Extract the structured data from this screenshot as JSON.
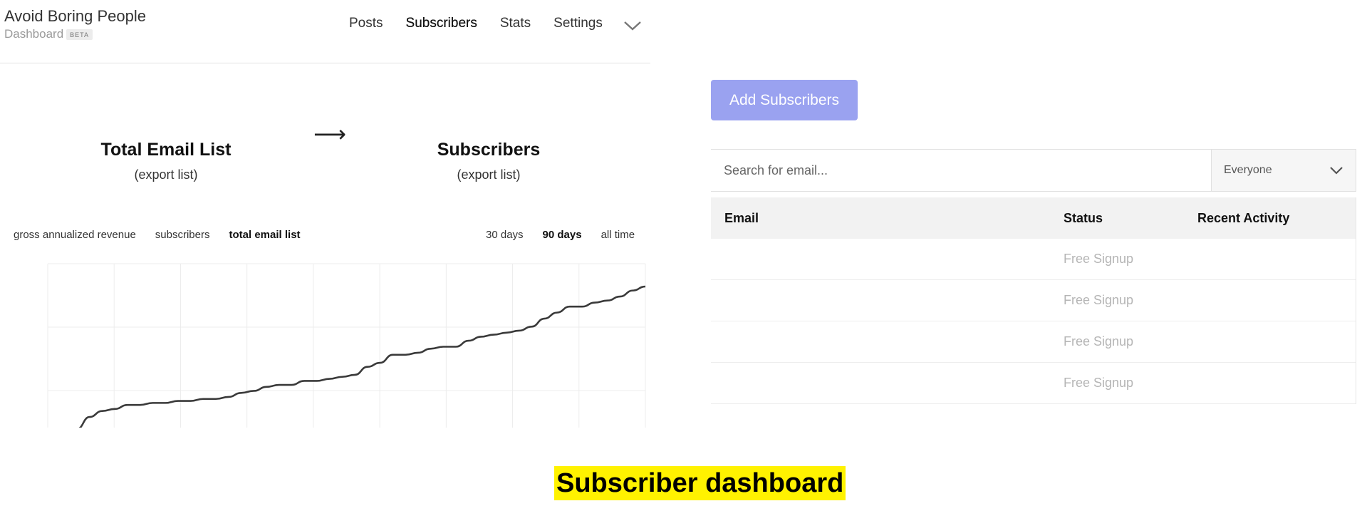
{
  "app": {
    "title": "Avoid Boring People",
    "subtitle": "Dashboard",
    "badge": "BETA"
  },
  "nav": {
    "items": [
      {
        "label": "Posts",
        "active": false
      },
      {
        "label": "Subscribers",
        "active": true
      },
      {
        "label": "Stats",
        "active": false
      },
      {
        "label": "Settings",
        "active": false
      }
    ],
    "menu_icon": "chevron-down-icon"
  },
  "stats": {
    "total_email_list": {
      "title": "Total Email List",
      "link": "(export list)"
    },
    "arrow_icon": "long-arrow-right-icon",
    "subscribers": {
      "title": "Subscribers",
      "link": "(export list)"
    }
  },
  "chart_controls": {
    "metrics": [
      {
        "label": "gross annualized revenue",
        "selected": false
      },
      {
        "label": "subscribers",
        "selected": false
      },
      {
        "label": "total email list",
        "selected": true
      }
    ],
    "ranges": [
      {
        "label": "30 days",
        "selected": false
      },
      {
        "label": "90 days",
        "selected": true
      },
      {
        "label": "all time",
        "selected": false
      }
    ]
  },
  "chart_data": {
    "type": "line",
    "title": "",
    "xlabel": "",
    "ylabel": "",
    "grid": true,
    "ylim": [
      0,
      100
    ],
    "series": [
      {
        "values": [
          0,
          6,
          9,
          10,
          12,
          12,
          13,
          13,
          14,
          14,
          15,
          15,
          16,
          18,
          19,
          21,
          22,
          22,
          24,
          24,
          25,
          26,
          27,
          31,
          33,
          37,
          37,
          38,
          40,
          41,
          41,
          44,
          46,
          47,
          48,
          49,
          51,
          55,
          58,
          61,
          61,
          63,
          64,
          66,
          69,
          71
        ]
      }
    ],
    "color": "#3a3a3a"
  },
  "actions": {
    "add_subscribers": "Add Subscribers"
  },
  "search": {
    "placeholder": "Search for email...",
    "value": "",
    "filter": {
      "selected": "Everyone"
    }
  },
  "table": {
    "headers": {
      "email": "Email",
      "status": "Status",
      "activity": "Recent Activity"
    },
    "rows": [
      {
        "email": "",
        "status": "Free Signup",
        "activity": ""
      },
      {
        "email": "",
        "status": "Free Signup",
        "activity": ""
      },
      {
        "email": "",
        "status": "Free Signup",
        "activity": ""
      },
      {
        "email": "",
        "status": "Free Signup",
        "activity": ""
      }
    ]
  },
  "caption": "Subscriber dashboard",
  "colors": {
    "accent_button": "#9aa2f0",
    "caption_highlight": "#fff200",
    "status_text": "#b5b5b5"
  }
}
